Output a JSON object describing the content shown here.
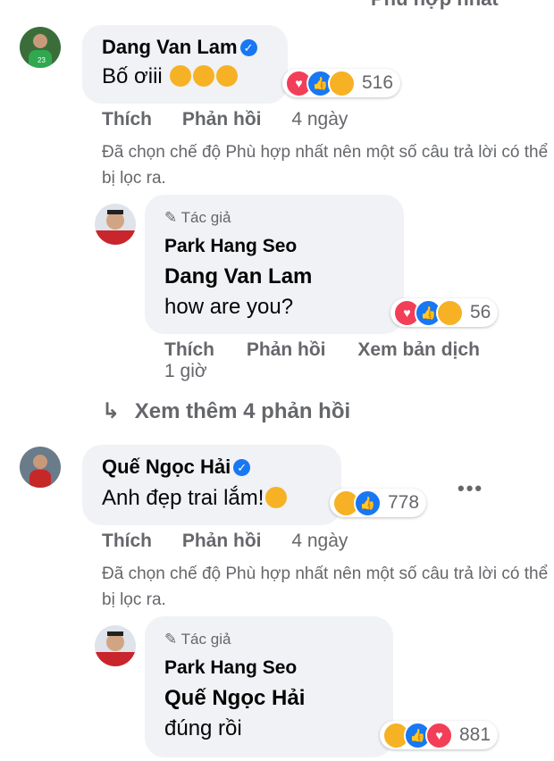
{
  "filter_label": "Phù hợp nhất",
  "comment1": {
    "author": "Dang Van Lam",
    "text": "Bố ơiii",
    "emoji": [
      "smiling-hearts",
      "smiling-hearts",
      "smiling-hearts"
    ],
    "reactions": [
      "love",
      "like",
      "care"
    ],
    "reaction_count": "516",
    "like": "Thích",
    "reply": "Phản hồi",
    "time": "4 ngày",
    "notice": "Đã chọn chế độ Phù hợp nhất nên một số câu trả lời có thể bị lọc ra."
  },
  "reply1": {
    "author_tag": "Tác giả",
    "author": "Park Hang Seo",
    "mention": "Dang Van Lam",
    "text": "how are you?",
    "reactions": [
      "love",
      "like",
      "care"
    ],
    "reaction_count": "56",
    "like": "Thích",
    "reply": "Phản hồi",
    "translate": "Xem bản dịch",
    "time": "1 giờ"
  },
  "more_replies": "Xem thêm 4 phản hồi",
  "comment2": {
    "author": "Quế Ngọc Hải",
    "text": "Anh đẹp trai lắm!",
    "emoji": [
      "hand-over-mouth"
    ],
    "reactions": [
      "haha",
      "like"
    ],
    "reaction_count": "778",
    "like": "Thích",
    "reply": "Phản hồi",
    "time": "4 ngày",
    "notice": "Đã chọn chế độ Phù hợp nhất nên một số câu trả lời có thể bị lọc ra.",
    "more_icon": "•••"
  },
  "reply2": {
    "author_tag": "Tác giả",
    "author": "Park Hang Seo",
    "mention": "Quế Ngọc Hải",
    "text": "đúng rồi",
    "reactions": [
      "haha",
      "like",
      "love"
    ],
    "reaction_count": "881"
  }
}
